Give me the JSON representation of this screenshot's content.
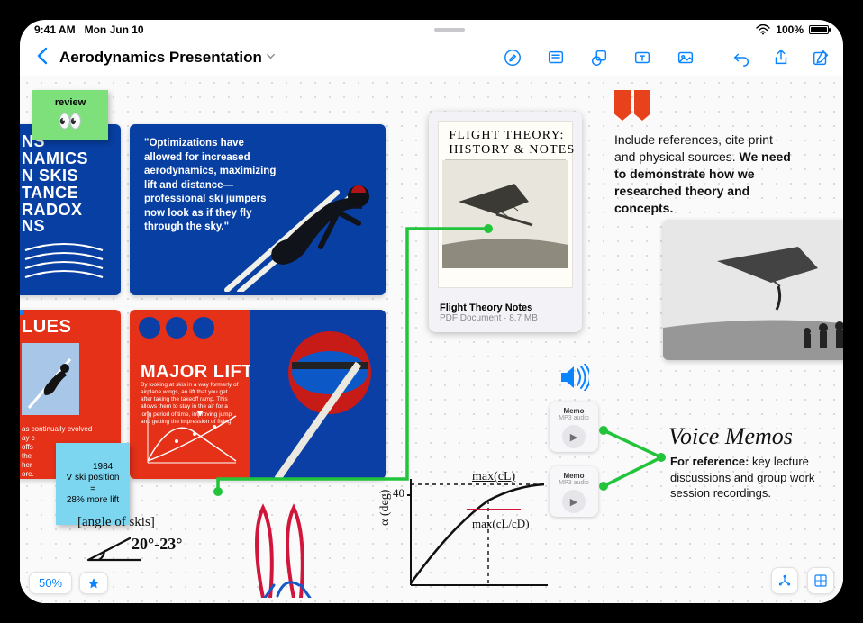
{
  "status": {
    "time": "9:41 AM",
    "date": "Mon Jun 10",
    "battery": "100%"
  },
  "toolbar": {
    "board_title": "Aerodynamics Presentation",
    "icons": [
      "pen-tool-icon",
      "note-tool-icon",
      "shape-tool-icon",
      "textbox-tool-icon",
      "media-tool-icon",
      "undo-icon",
      "share-icon",
      "compose-icon"
    ]
  },
  "stickies": {
    "review": {
      "text": "review",
      "emoji": "👀"
    },
    "vski": "1984\nV ski position\n=\n28% more lift"
  },
  "slides": {
    "left_blue_title": "NS\nNAMICS\nN SKIS\nTANCE\nRADOX\nNS",
    "quote": "\"Optimizations have allowed for increased aerodynamics, maximizing lift and distance—professional ski jumpers now look as if they fly through the sky.\"",
    "red_title": "LUES",
    "red_body": "as continually evolved\nay c\noffs\nthe\nher\nore.",
    "major_lift": "MAJOR LIFT",
    "major_lift_body": "By looking at skis in a way formerly of airplane wings, an lift that you get after taking the takeoff ramp. This allows them to stay in the air for a long period of time, improving jump and getting the impression of flying."
  },
  "doc": {
    "thumb_title": "FLIGHT THEORY:\nHISTORY & NOTES",
    "name": "Flight Theory Notes",
    "sub": "PDF Document · 8.7 MB"
  },
  "ref_text": {
    "line1": "Include references, cite print and physical sources.",
    "line2": "We need to demonstrate how we researched theory and concepts."
  },
  "audio": [
    {
      "title": "Memo",
      "sub": "MP3 audio"
    },
    {
      "title": "Memo",
      "sub": "MP3 audio"
    }
  ],
  "voice": {
    "heading": "Voice Memos",
    "body_bold": "For reference:",
    "body_rest": " key lecture discussions and group work session recordings."
  },
  "hand": {
    "angle_label": "[angle of skis]",
    "angle_value": "20°-23°",
    "graph_y": "α (deg)",
    "graph_tick": "40",
    "graph_top": "max(cL)",
    "graph_mid": "max(cL/cD)"
  },
  "bottom": {
    "zoom": "50%"
  },
  "chart_data": {
    "type": "line",
    "title": "",
    "xlabel": "",
    "ylabel": "α (deg)",
    "ylim": [
      0,
      50
    ],
    "annotations": [
      "max(cL)",
      "max(cL/cD)"
    ],
    "x": [
      0,
      10,
      20,
      30,
      40,
      50
    ],
    "values": [
      0,
      20,
      31,
      37,
      39.5,
      40
    ],
    "note": "hand-sketched saturating lift curve; values estimated from drawing"
  }
}
